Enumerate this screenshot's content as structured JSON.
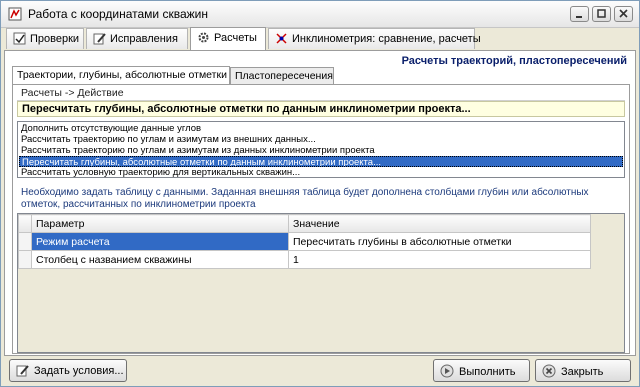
{
  "window": {
    "title": "Работа с координатами скважин",
    "controls": [
      "minimize-icon",
      "maximize-icon",
      "close-icon"
    ]
  },
  "top_tabs": [
    {
      "label": "Проверки",
      "icon": "check-icon"
    },
    {
      "label": "Исправления",
      "icon": "pencil-icon"
    },
    {
      "label": "Расчеты",
      "icon": "gear-icon",
      "active": true
    },
    {
      "label": "Инклинометрия: сравнение, расчеты",
      "icon": "inclinometry-icon"
    }
  ],
  "section_title": "Расчеты траекторий, пластопересечений",
  "inner_tabs": [
    {
      "label": "Траектории, глубины, абсолютные отметки",
      "active": true
    },
    {
      "label": "Пластопересечения"
    }
  ],
  "breadcrumb": "Расчеты -> Действие",
  "selected_action": "Пересчитать глубины, абсолютные отметки по данным инклинометрии проекта...",
  "actions": [
    "Дополнить отсутствующие данные углов",
    "Рассчитать траекторию по углам и азимутам из внешних данных...",
    "Рассчитать траекторию по углам и азимутам из данных инклинометрии проекта",
    "Пересчитать глубины, абсолютные отметки по данным инклинометрии проекта...",
    "Рассчитать условную траекторию для вертикальных скважин..."
  ],
  "selected_index": 3,
  "description": "Необходимо задать таблицу с данными. Заданная внешняя таблица будет дополнена столбцами глубин или абсолютных отметок, рассчитанных по инклинометрии проекта",
  "params_table": {
    "headers": [
      "Параметр",
      "Значение"
    ],
    "rows": [
      {
        "param": "Режим расчета",
        "value": "Пересчитать глубины в абсолютные отметки",
        "selected": true
      },
      {
        "param": "Столбец с названием скважины",
        "value": "1"
      }
    ]
  },
  "buttons": {
    "set_conditions": "Задать условия...",
    "run": "Выполнить",
    "close": "Закрыть"
  },
  "colors": {
    "selection": "#316ac5",
    "section_title": "#0a1f6b",
    "description": "#1c3a7c"
  }
}
